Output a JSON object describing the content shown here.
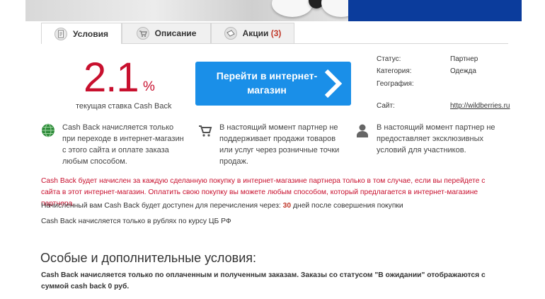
{
  "tabs": [
    {
      "label": "Условия",
      "icon": "document-icon",
      "active": true
    },
    {
      "label": "Описание",
      "icon": "cart-icon",
      "active": false
    },
    {
      "label": "Акции",
      "count": "(3)",
      "icon": "ticket-icon",
      "active": false
    }
  ],
  "cashback": {
    "rate": "2.1",
    "unit": "%",
    "caption": "текущая ставка Cash Back"
  },
  "go_button": {
    "label": "Перейти в интернет-магазин",
    "icon": "chevron-right-icon"
  },
  "info": {
    "status_label": "Статус:",
    "status_value": "Партнер",
    "category_label": "Категория:",
    "category_value": "Одежда",
    "geo_label": "География:",
    "site_label": "Сайт:",
    "site_value": "http://wildberries.ru"
  },
  "features": [
    {
      "icon": "globe-icon",
      "text": "Cash Back начисляется только при переходе в интернет-магазин с этого сайта и оплате заказа любым способом."
    },
    {
      "icon": "cart-icon",
      "text": "В настоящий момент партнер не поддерживает продажи товаров или услуг через розничные точки продаж."
    },
    {
      "icon": "user-icon",
      "text": "В настоящий момент партнер не предоставляет эксклюзивных условий для участников."
    }
  ],
  "notes": {
    "red": "Cash Back будет начислен за каждую сделанную покупку в интернет-магазине партнера только в том случае, если вы перейдете с сайта в этот интернет-магазин. Оплатить свою покупку вы можете любым способом, который предлагается в интернет-магазине партнера.",
    "available_prefix": "Начисленный вам Cash Back будет доступен для перечисления через:",
    "available_days": "30",
    "available_suffix": "дней после совершения покупки",
    "rubles": "Cash Back начисляется только в рублях по курсу ЦБ РФ"
  },
  "extra": {
    "title": "Особые и дополнительные условия:",
    "text": "Cash Back начисляется только по оплаченным и полученным заказам. Заказы со статусом \"В ожидании\" отображаются с суммой cash back 0 руб."
  },
  "colors": {
    "accent_red": "#c8102e",
    "button_blue": "#1a8fe8",
    "banner_blue": "#0b3c9c"
  }
}
